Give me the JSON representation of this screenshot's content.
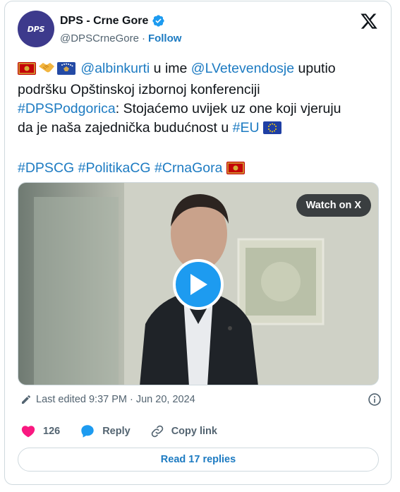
{
  "author": {
    "display_name": "DPS - Crne Gore",
    "handle": "@DPSCrneGore",
    "separator": "·",
    "follow_label": "Follow",
    "avatar_text": "DPS",
    "verified": true
  },
  "tweet": {
    "lines": [
      [
        {
          "type": "emoji",
          "name": "montenegro-flag"
        },
        {
          "type": "emoji",
          "name": "handshake"
        },
        {
          "type": "emoji",
          "name": "kosovo-flag"
        },
        {
          "type": "link",
          "text": " @albinkurti"
        },
        {
          "type": "text",
          "text": " u ime "
        },
        {
          "type": "link",
          "text": "@LVetevendosje"
        },
        {
          "type": "text",
          "text": " uputio"
        }
      ],
      [
        {
          "type": "text",
          "text": "podršku Opštinskoj izbornoj konferenciji"
        }
      ],
      [
        {
          "type": "link",
          "text": "#DPSPodgorica"
        },
        {
          "type": "text",
          "text": ": Stojaćemo uvijek uz one koji vjeruju"
        }
      ],
      [
        {
          "type": "text",
          "text": "da je naša zajednička budućnost u "
        },
        {
          "type": "link",
          "text": "#EU"
        },
        {
          "type": "text",
          "text": " "
        },
        {
          "type": "emoji",
          "name": "eu-flag"
        }
      ],
      [],
      [
        {
          "type": "link",
          "text": "#DPSCG"
        },
        {
          "type": "text",
          "text": " "
        },
        {
          "type": "link",
          "text": "#PolitikaCG"
        },
        {
          "type": "text",
          "text": " "
        },
        {
          "type": "link",
          "text": "#CrnaGora"
        },
        {
          "type": "text",
          "text": " "
        },
        {
          "type": "emoji",
          "name": "montenegro-flag"
        }
      ]
    ]
  },
  "media": {
    "watch_label": "Watch on X"
  },
  "meta": {
    "edited_label": "Last edited 9:37 PM · Jun 20, 2024"
  },
  "actions": {
    "likes_count": "126",
    "reply_label": "Reply",
    "copy_link_label": "Copy link"
  },
  "read_replies_label": "Read 17 replies",
  "colors": {
    "link": "#1d7bc2",
    "like": "#f91880",
    "muted": "#536471",
    "border": "#cfd9de",
    "play": "#1d9bf0"
  }
}
